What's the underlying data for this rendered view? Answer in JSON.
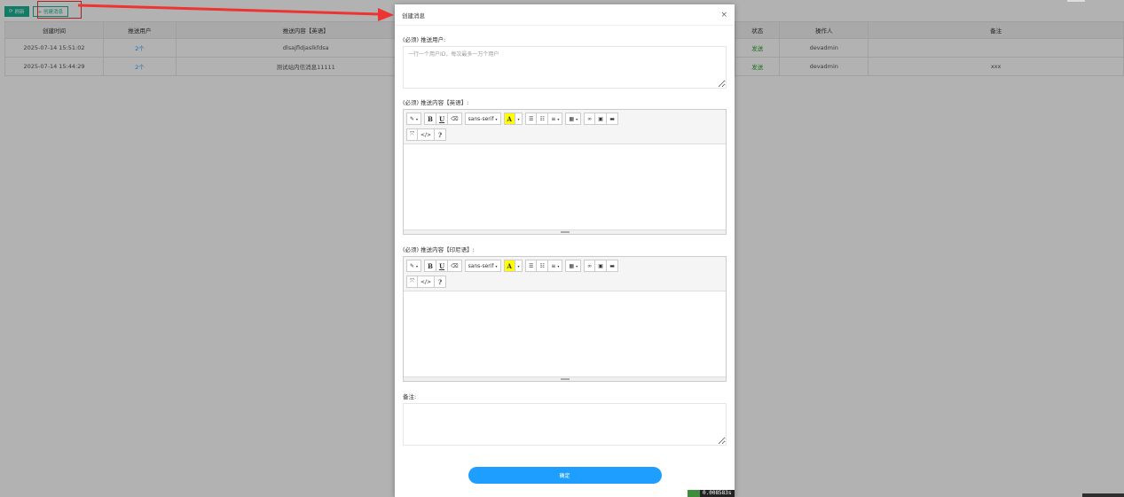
{
  "toolbar": {
    "refresh_label": "刷新",
    "create_label": "+ 创建消息"
  },
  "table": {
    "columns": [
      "创建时间",
      "推送用户",
      "推送内容【英语】",
      "",
      "状态",
      "操作人",
      "备注"
    ],
    "rows": [
      {
        "created": "2025-07-14 15:51:02",
        "users": "2个",
        "content": "dlsajfldjaslkfdsa",
        "status": "发送",
        "operator": "devadmin",
        "remark": ""
      },
      {
        "created": "2025-07-14 15:44:29",
        "users": "2个",
        "content": "测试站内信消息11111",
        "status": "发送",
        "operator": "devadmin",
        "remark": "xxx"
      }
    ]
  },
  "modal": {
    "title": "创建消息",
    "close_glyph": "×",
    "users_label": "(必须) 推送用户:",
    "users_placeholder": "一行一个用户ID，每次最多一万个用户",
    "content_en_label": "(必须) 推送内容【英语】:",
    "content_id_label": "(必须) 推送内容【印尼语】:",
    "remark_label": "备注:",
    "submit_label": "确定"
  },
  "editor_toolbar": {
    "style": "▾",
    "bold": "B",
    "underline": "U",
    "font_name": "sans-serif",
    "color_a": "A",
    "code": "</>",
    "help": "?"
  },
  "icons": [
    "refresh-icon",
    "magic-icon",
    "eraser-icon",
    "list-ul-icon",
    "list-ol-icon",
    "align-icon",
    "table-icon",
    "link-icon",
    "picture-icon",
    "video-icon",
    "fullscreen-icon",
    "code-icon",
    "help-icon"
  ],
  "colors": {
    "accent_green": "#1ab394",
    "primary_blue": "#1e9fff",
    "status_green": "#2a9d2a",
    "annotation_red": "#e33"
  },
  "perf": {
    "time": "0.008583s"
  }
}
